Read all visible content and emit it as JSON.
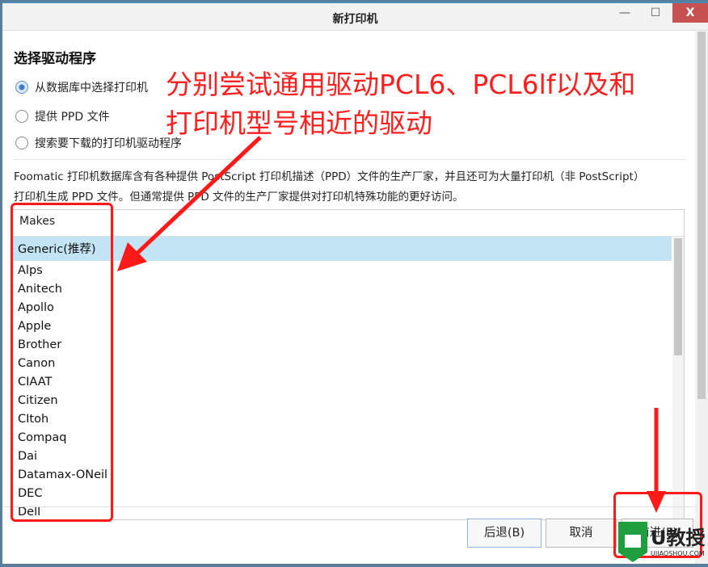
{
  "window": {
    "title": "新打印机",
    "minimize_label": "—",
    "maximize_label": "☐",
    "close_label": "X"
  },
  "page": {
    "heading": "选择驱动程序",
    "options": [
      {
        "label": "从数据库中选择打印机",
        "selected": true
      },
      {
        "label": "提供 PPD 文件",
        "selected": false
      },
      {
        "label": "搜索要下载的打印机驱动程序",
        "selected": false
      }
    ],
    "description": "Foomatic 打印机数据库含有各种提供 PostScript 打印机描述（PPD）文件的生产厂家，并且还可为大量打印机（非 PostScript）打印机生成 PPD 文件。但通常提供 PPD 文件的生产厂家提供对打印机特殊功能的更好访问。",
    "list": {
      "header": "Makes",
      "selected": "Generic(推荐)",
      "items": [
        "Generic(推荐)",
        "Alps",
        "Anitech",
        "Apollo",
        "Apple",
        "Brother",
        "Canon",
        "CIAAT",
        "Citizen",
        "CItoh",
        "Compaq",
        "Dai",
        "Datamax-ONeil",
        "DEC",
        "Dell"
      ]
    },
    "buttons": {
      "back": "后退(B)",
      "cancel": "取消",
      "forward": "前进(F)"
    }
  },
  "annotation": {
    "line1": "分别尝试通用驱动PCL6、PCL6lf以及和",
    "line2": "打印机型号相近的驱动",
    "color": "#ff1a1a"
  },
  "watermark": {
    "brand": "U教授",
    "site": "UJIAOSHOU.COM"
  }
}
